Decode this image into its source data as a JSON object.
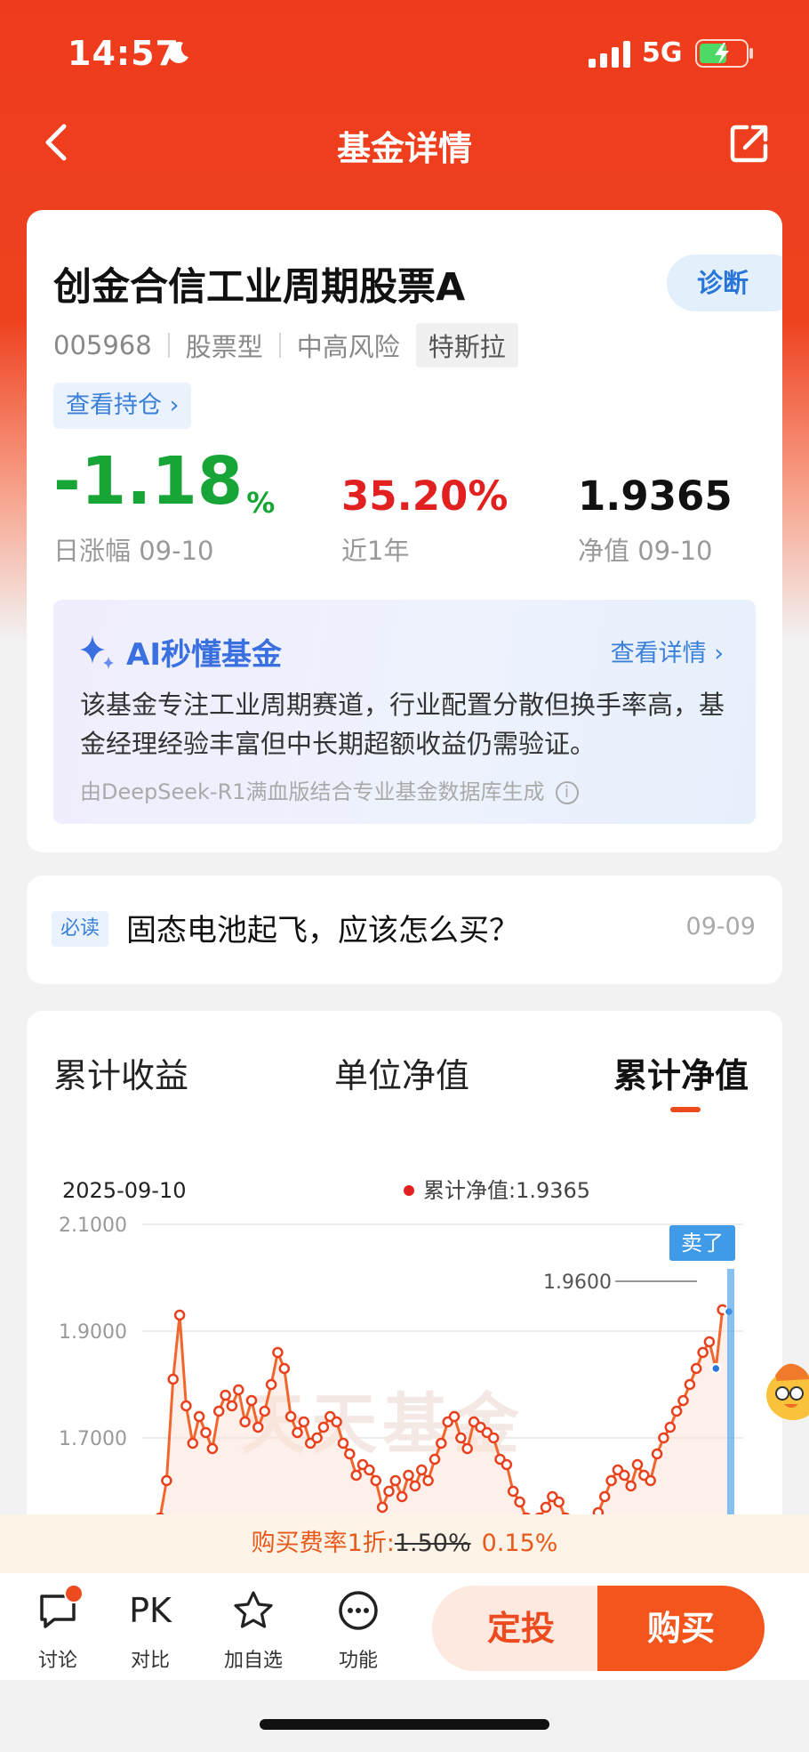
{
  "status_bar": {
    "time": "14:57",
    "network": "5G"
  },
  "nav": {
    "title": "基金详情"
  },
  "fund": {
    "name": "创金合信工业周期股票A",
    "code": "005968",
    "type": "股票型",
    "risk": "中高风险",
    "tag": "特斯拉",
    "diagnose_label": "诊断",
    "holdings_label": "查看持仓 ›"
  },
  "stats": {
    "daily_change": "-1.18",
    "daily_change_unit": "%",
    "daily_change_label": "日涨幅 09-10",
    "year_return": "35.20%",
    "year_return_label": "近1年",
    "nav_value": "1.9365",
    "nav_label": "净值 09-10"
  },
  "ai": {
    "title": "AI秒懂基金",
    "more": "查看详情 ›",
    "summary": "该基金专注工业周期赛道，行业配置分散但换手率高，基金经理经验丰富但中长期超额收益仍需验证。",
    "source": "由DeepSeek-R1满血版结合专业基金数据库生成"
  },
  "news": {
    "badge": "必读",
    "title": "固态电池起飞，应该怎么买？",
    "date": "09-09"
  },
  "chart_tabs": [
    "累计收益",
    "单位净值",
    "累计净值"
  ],
  "chart": {
    "date": "2025-09-10",
    "legend": "累计净值:1.9365",
    "watermark": "天天基金",
    "sell_marker": "卖了",
    "sell_price": "1.9600"
  },
  "chart_data": {
    "type": "area",
    "y_ticks": [
      "2.1000",
      "1.9000",
      "1.7000"
    ],
    "ylim": [
      1.45,
      2.1
    ],
    "series": [
      {
        "name": "累计净值",
        "values": [
          1.55,
          1.62,
          1.81,
          1.93,
          1.76,
          1.69,
          1.74,
          1.71,
          1.68,
          1.75,
          1.78,
          1.76,
          1.79,
          1.73,
          1.77,
          1.72,
          1.75,
          1.8,
          1.86,
          1.83,
          1.74,
          1.71,
          1.73,
          1.69,
          1.7,
          1.72,
          1.74,
          1.73,
          1.69,
          1.67,
          1.63,
          1.65,
          1.64,
          1.62,
          1.57,
          1.6,
          1.62,
          1.59,
          1.63,
          1.61,
          1.64,
          1.62,
          1.66,
          1.69,
          1.73,
          1.74,
          1.7,
          1.68,
          1.73,
          1.72,
          1.71,
          1.7,
          1.66,
          1.65,
          1.6,
          1.58,
          1.55,
          1.53,
          1.55,
          1.57,
          1.59,
          1.58,
          1.55,
          1.53,
          1.51,
          1.52,
          1.54,
          1.56,
          1.59,
          1.62,
          1.64,
          1.63,
          1.61,
          1.65,
          1.63,
          1.62,
          1.67,
          1.7,
          1.72,
          1.75,
          1.77,
          1.8,
          1.83,
          1.86,
          1.88,
          1.83,
          1.94,
          1.9365
        ]
      }
    ]
  },
  "fee": {
    "prefix": "购买费率1折:",
    "old_rate": "1.50%",
    "new_rate": "0.15%"
  },
  "bottom_bar": {
    "discuss": "讨论",
    "pk_text": "PK",
    "compare": "对比",
    "watchlist": "加自选",
    "functions": "功能",
    "auto_invest": "定投",
    "buy": "购买"
  },
  "colors": {
    "brand": "#ee3b1c",
    "up": "#e32020",
    "down": "#18a537",
    "link": "#3a7fd8",
    "line": "#f2662e"
  }
}
